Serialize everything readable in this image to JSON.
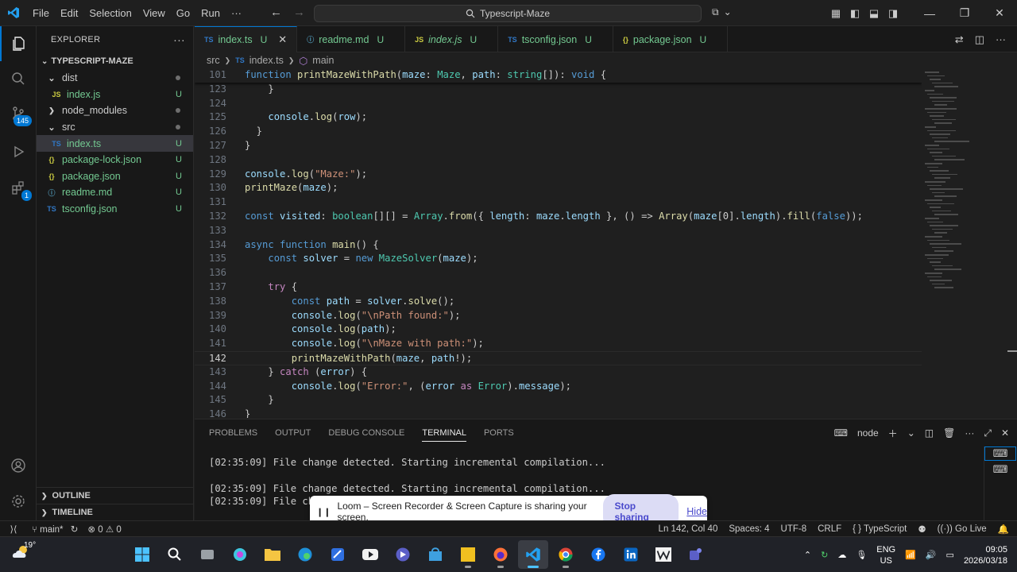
{
  "titlebar": {
    "menus": [
      "File",
      "Edit",
      "Selection",
      "View",
      "Go",
      "Run",
      "···"
    ],
    "search_text": "Typescript-Maze"
  },
  "activity_bar": {
    "source_control_badge": "145",
    "extensions_badge": "1"
  },
  "sidebar": {
    "header": "EXPLORER",
    "project": "TYPESCRIPT-MAZE",
    "tree": [
      {
        "name": "dist",
        "kind": "folder-open",
        "depth": 0,
        "status": "dot"
      },
      {
        "name": "index.js",
        "kind": "js",
        "depth": 1,
        "status": "U"
      },
      {
        "name": "node_modules",
        "kind": "folder-closed",
        "depth": 0,
        "status": "dot"
      },
      {
        "name": "src",
        "kind": "folder-open",
        "depth": 0,
        "status": "dot"
      },
      {
        "name": "index.ts",
        "kind": "ts",
        "depth": 1,
        "status": "U",
        "selected": true
      },
      {
        "name": "package-lock.json",
        "kind": "json",
        "depth": 0,
        "status": "U"
      },
      {
        "name": "package.json",
        "kind": "json",
        "depth": 0,
        "status": "U"
      },
      {
        "name": "readme.md",
        "kind": "md",
        "depth": 0,
        "status": "U"
      },
      {
        "name": "tsconfig.json",
        "kind": "ts",
        "depth": 0,
        "status": "U"
      }
    ],
    "outline": "OUTLINE",
    "timeline": "TIMELINE"
  },
  "tabs": [
    {
      "icon": "TS",
      "label": "index.ts",
      "status": "U",
      "active": true
    },
    {
      "icon": "ⓘ",
      "label": "readme.md",
      "status": "U"
    },
    {
      "icon": "JS",
      "label": "index.js",
      "status": "U"
    },
    {
      "icon": "TS",
      "label": "tsconfig.json",
      "status": "U"
    },
    {
      "icon": "{}",
      "label": "package.json",
      "status": "U"
    }
  ],
  "breadcrumb": {
    "folder": "src",
    "file": "index.ts",
    "symbol": "main"
  },
  "code_lines": [
    {
      "n": "101",
      "tokens": [
        [
          "k",
          "function "
        ],
        [
          "fn",
          "printMazeWithPath"
        ],
        [
          "pn",
          "("
        ],
        [
          "vr",
          "maze"
        ],
        [
          "pn",
          ": "
        ],
        [
          "ty",
          "Maze"
        ],
        [
          "pn",
          ", "
        ],
        [
          "vr",
          "path"
        ],
        [
          "pn",
          ": "
        ],
        [
          "ty",
          "string"
        ],
        [
          "pn",
          "[]): "
        ],
        [
          "k",
          "void"
        ],
        [
          "pn",
          " {"
        ]
      ]
    },
    {
      "n": "123",
      "tokens": [
        [
          "pn",
          "    }"
        ]
      ]
    },
    {
      "n": "124",
      "tokens": []
    },
    {
      "n": "125",
      "tokens": [
        [
          "pn",
          "    "
        ],
        [
          "vr",
          "console"
        ],
        [
          "pn",
          "."
        ],
        [
          "fn",
          "log"
        ],
        [
          "pn",
          "("
        ],
        [
          "vr",
          "row"
        ],
        [
          "pn",
          ");"
        ]
      ]
    },
    {
      "n": "126",
      "tokens": [
        [
          "pn",
          "  }"
        ]
      ]
    },
    {
      "n": "127",
      "tokens": [
        [
          "pn",
          "}"
        ]
      ]
    },
    {
      "n": "128",
      "tokens": []
    },
    {
      "n": "129",
      "tokens": [
        [
          "vr",
          "console"
        ],
        [
          "pn",
          "."
        ],
        [
          "fn",
          "log"
        ],
        [
          "pn",
          "("
        ],
        [
          "st",
          "\"Maze:\""
        ],
        [
          "pn",
          ");"
        ]
      ]
    },
    {
      "n": "130",
      "tokens": [
        [
          "fn",
          "printMaze"
        ],
        [
          "pn",
          "("
        ],
        [
          "vr",
          "maze"
        ],
        [
          "pn",
          ");"
        ]
      ]
    },
    {
      "n": "131",
      "tokens": []
    },
    {
      "n": "132",
      "tokens": [
        [
          "k",
          "const "
        ],
        [
          "vr",
          "visited"
        ],
        [
          "pn",
          ": "
        ],
        [
          "ty",
          "boolean"
        ],
        [
          "pn",
          "[][] = "
        ],
        [
          "ty",
          "Array"
        ],
        [
          "pn",
          "."
        ],
        [
          "fn",
          "from"
        ],
        [
          "pn",
          "({ "
        ],
        [
          "vr",
          "length"
        ],
        [
          "pn",
          ": "
        ],
        [
          "vr",
          "maze"
        ],
        [
          "pn",
          "."
        ],
        [
          "vr",
          "length"
        ],
        [
          "pn",
          " }, () => "
        ],
        [
          "fn",
          "Array"
        ],
        [
          "pn",
          "("
        ],
        [
          "vr",
          "maze"
        ],
        [
          "pn",
          "[0]."
        ],
        [
          "vr",
          "length"
        ],
        [
          "pn",
          ")."
        ],
        [
          "fn",
          "fill"
        ],
        [
          "pn",
          "("
        ],
        [
          "k",
          "false"
        ],
        [
          "pn",
          "));"
        ]
      ]
    },
    {
      "n": "133",
      "tokens": []
    },
    {
      "n": "134",
      "tokens": [
        [
          "k",
          "async function "
        ],
        [
          "fn",
          "main"
        ],
        [
          "pn",
          "() {"
        ]
      ]
    },
    {
      "n": "135",
      "tokens": [
        [
          "pn",
          "    "
        ],
        [
          "k",
          "const "
        ],
        [
          "vr",
          "solver"
        ],
        [
          "pn",
          " = "
        ],
        [
          "k",
          "new "
        ],
        [
          "ty",
          "MazeSolver"
        ],
        [
          "pn",
          "("
        ],
        [
          "vr",
          "maze"
        ],
        [
          "pn",
          ");"
        ]
      ]
    },
    {
      "n": "136",
      "tokens": []
    },
    {
      "n": "137",
      "tokens": [
        [
          "pn",
          "    "
        ],
        [
          "kc",
          "try"
        ],
        [
          "pn",
          " {"
        ]
      ]
    },
    {
      "n": "138",
      "tokens": [
        [
          "pn",
          "        "
        ],
        [
          "k",
          "const "
        ],
        [
          "vr",
          "path"
        ],
        [
          "pn",
          " = "
        ],
        [
          "vr",
          "solver"
        ],
        [
          "pn",
          "."
        ],
        [
          "fn",
          "solve"
        ],
        [
          "pn",
          "();"
        ]
      ]
    },
    {
      "n": "139",
      "tokens": [
        [
          "pn",
          "        "
        ],
        [
          "vr",
          "console"
        ],
        [
          "pn",
          "."
        ],
        [
          "fn",
          "log"
        ],
        [
          "pn",
          "("
        ],
        [
          "st",
          "\"\\nPath found:\""
        ],
        [
          "pn",
          ");"
        ]
      ]
    },
    {
      "n": "140",
      "tokens": [
        [
          "pn",
          "        "
        ],
        [
          "vr",
          "console"
        ],
        [
          "pn",
          "."
        ],
        [
          "fn",
          "log"
        ],
        [
          "pn",
          "("
        ],
        [
          "vr",
          "path"
        ],
        [
          "pn",
          ");"
        ]
      ]
    },
    {
      "n": "141",
      "tokens": [
        [
          "pn",
          "        "
        ],
        [
          "vr",
          "console"
        ],
        [
          "pn",
          "."
        ],
        [
          "fn",
          "log"
        ],
        [
          "pn",
          "("
        ],
        [
          "st",
          "\"\\nMaze with path:\""
        ],
        [
          "pn",
          ");"
        ]
      ]
    },
    {
      "n": "142",
      "tokens": [
        [
          "pn",
          "        "
        ],
        [
          "fn",
          "printMazeWithPath"
        ],
        [
          "pn",
          "("
        ],
        [
          "vr",
          "maze"
        ],
        [
          "pn",
          ", "
        ],
        [
          "vr",
          "path"
        ],
        [
          "pn",
          "!);"
        ]
      ],
      "current": true
    },
    {
      "n": "143",
      "tokens": [
        [
          "pn",
          "    } "
        ],
        [
          "kc",
          "catch"
        ],
        [
          "pn",
          " ("
        ],
        [
          "vr",
          "error"
        ],
        [
          "pn",
          ") {"
        ]
      ]
    },
    {
      "n": "144",
      "tokens": [
        [
          "pn",
          "        "
        ],
        [
          "vr",
          "console"
        ],
        [
          "pn",
          "."
        ],
        [
          "fn",
          "log"
        ],
        [
          "pn",
          "("
        ],
        [
          "st",
          "\"Error:\""
        ],
        [
          "pn",
          ", ("
        ],
        [
          "vr",
          "error"
        ],
        [
          "pn",
          " "
        ],
        [
          "kc",
          "as"
        ],
        [
          "pn",
          " "
        ],
        [
          "ty",
          "Error"
        ],
        [
          "pn",
          ")."
        ],
        [
          "vr",
          "message"
        ],
        [
          "pn",
          ");"
        ]
      ]
    },
    {
      "n": "145",
      "tokens": [
        [
          "pn",
          "    }"
        ]
      ]
    },
    {
      "n": "146",
      "tokens": [
        [
          "pn",
          "}"
        ]
      ]
    }
  ],
  "panel": {
    "tabs": [
      "PROBLEMS",
      "OUTPUT",
      "DEBUG CONSOLE",
      "TERMINAL",
      "PORTS"
    ],
    "active_tab": "TERMINAL",
    "terminal_label": "node",
    "terminal_lines": [
      "[02:35:09] File change detected. Starting incremental compilation...",
      "",
      "[02:35:09] File change detected. Starting incremental compilation...",
      "[02:35:09] File cha"
    ]
  },
  "loom": {
    "message": "Loom – Screen Recorder & Screen Capture is sharing your screen.",
    "stop_label": "Stop sharing",
    "hide_label": "Hide"
  },
  "statusbar": {
    "branch": "main*",
    "errors": "0",
    "warnings": "0",
    "position": "Ln 142, Col 40",
    "spaces": "Spaces: 4",
    "encoding": "UTF-8",
    "eol": "CRLF",
    "language": "TypeScript",
    "golive": "Go Live"
  },
  "taskbar": {
    "weather_temp": "19°",
    "lang": "ENG",
    "region": "US",
    "time": "09:05",
    "date": "2026/03/18"
  }
}
